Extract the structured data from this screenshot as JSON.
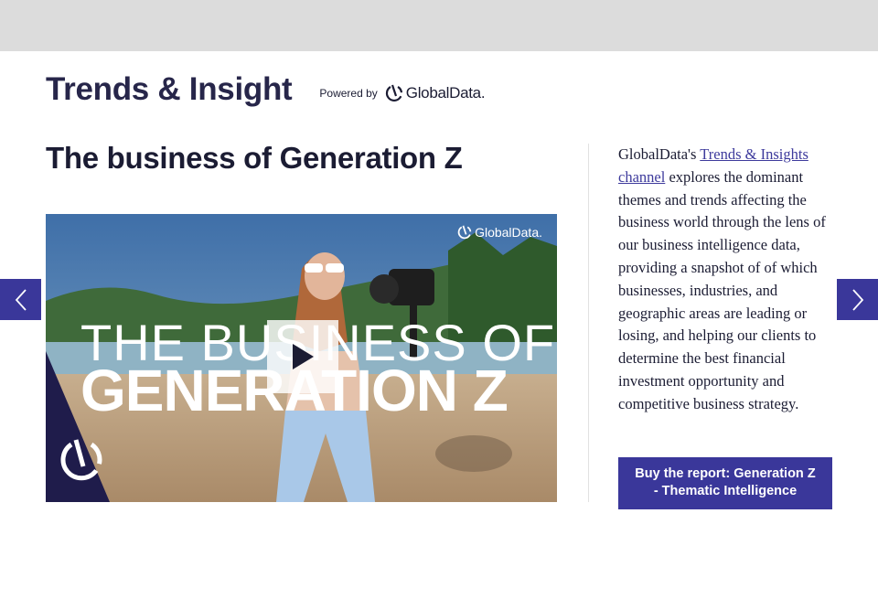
{
  "header": {
    "brand_title": "Trends & Insight",
    "powered_by_label": "Powered by",
    "logo_text": "GlobalData."
  },
  "article": {
    "title": "The business of Generation Z"
  },
  "video": {
    "title_line1": "THE BUSINESS OF",
    "title_line2": "GENERATION Z",
    "watermark_text": "GlobalData.",
    "play_icon": "play-icon"
  },
  "sidebar": {
    "desc_prefix": "GlobalData's ",
    "link_text": "Trends & Insights channel",
    "desc_suffix": " explores the dominant themes and trends affecting the business world through the lens of our business intelligence data, providing a snapshot of of which businesses, industries, and geographic areas are leading or losing, and helping our clients to determine the best financial investment opportunity and competitive business strategy.",
    "buy_button_label": "Buy the report: Generation Z - Thematic Intelligence"
  },
  "carousel": {
    "prev_icon": "chevron-left-icon",
    "next_icon": "chevron-right-icon"
  },
  "colors": {
    "accent": "#3a379a",
    "brand_title": "#27264a",
    "top_band": "#dcdcdc"
  }
}
